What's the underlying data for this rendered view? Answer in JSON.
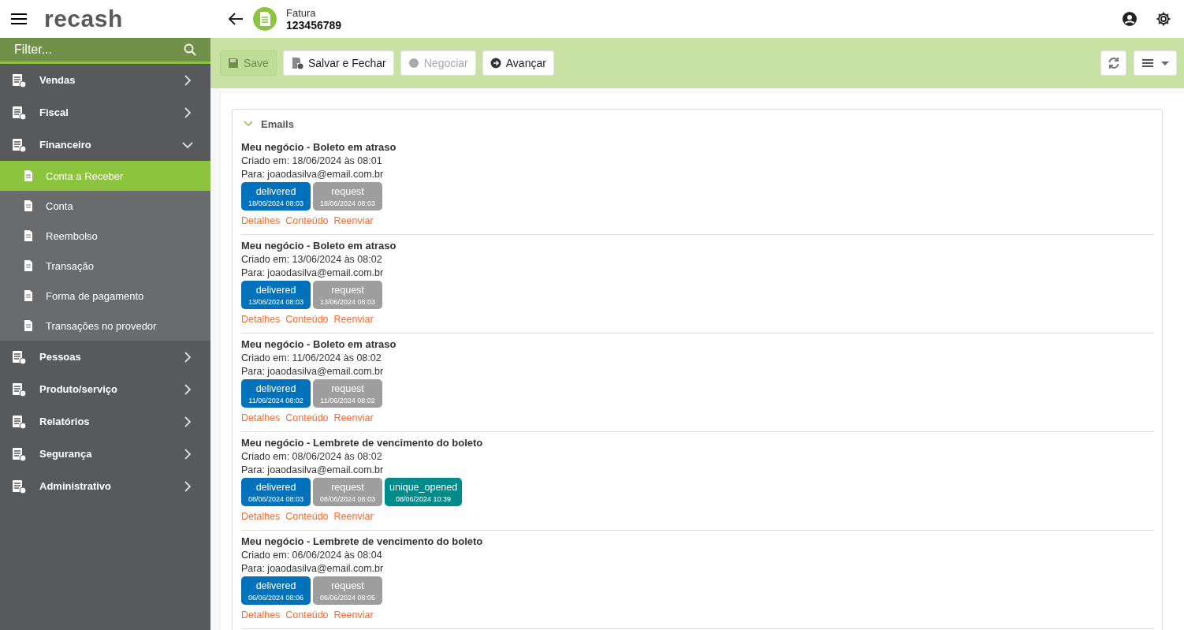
{
  "header": {
    "logo": "recash",
    "record_type": "Fatura",
    "record_number": "123456789"
  },
  "sidebar": {
    "filter_placeholder": "Filter...",
    "items": [
      {
        "label": "Vendas",
        "expanded": false
      },
      {
        "label": "Fiscal",
        "expanded": false
      },
      {
        "label": "Financeiro",
        "expanded": true,
        "children": [
          {
            "label": "Conta a Receber",
            "selected": true
          },
          {
            "label": "Conta",
            "selected": false
          },
          {
            "label": "Reembolso",
            "selected": false
          },
          {
            "label": "Transação",
            "selected": false
          },
          {
            "label": "Forma de pagamento",
            "selected": false
          },
          {
            "label": "Transações no provedor",
            "selected": false
          }
        ]
      },
      {
        "label": "Pessoas",
        "expanded": false
      },
      {
        "label": "Produto/serviço",
        "expanded": false
      },
      {
        "label": "Relatórios",
        "expanded": false
      },
      {
        "label": "Segurança",
        "expanded": false
      },
      {
        "label": "Administrativo",
        "expanded": false
      }
    ]
  },
  "toolbar": {
    "buttons": [
      {
        "label": "Save",
        "disabled": true
      },
      {
        "label": "Salvar e Fechar",
        "disabled": false
      },
      {
        "label": "Negociar",
        "disabled": true
      },
      {
        "label": "Avançar",
        "disabled": false
      }
    ]
  },
  "emails_panel": {
    "title": "Emails",
    "expanded": true,
    "emails": [
      {
        "subject": "Meu negócio - Boleto em atraso",
        "created": "Criado em: 18/06/2024 às 08:01",
        "to": "Para: joaodasilva@email.com.br",
        "events": [
          {
            "name": "delivered",
            "time": "18/06/2024 08:03",
            "color": "#0072bb"
          },
          {
            "name": "request",
            "time": "18/06/2024 08:03",
            "color": "#9e9e9e"
          }
        ],
        "links": [
          "Detalhes",
          "Conteúdo",
          "Reenviar"
        ]
      },
      {
        "subject": "Meu negócio - Boleto em atraso",
        "created": "Criado em: 13/06/2024 às 08:02",
        "to": "Para: joaodasilva@email.com.br",
        "events": [
          {
            "name": "delivered",
            "time": "13/06/2024 08:03",
            "color": "#0072bb"
          },
          {
            "name": "request",
            "time": "13/06/2024 08:03",
            "color": "#9e9e9e"
          }
        ],
        "links": [
          "Detalhes",
          "Conteúdo",
          "Reenviar"
        ]
      },
      {
        "subject": "Meu negócio - Boleto em atraso",
        "created": "Criado em: 11/06/2024 às 08:02",
        "to": "Para: joaodasilva@email.com.br",
        "events": [
          {
            "name": "delivered",
            "time": "11/06/2024 08:02",
            "color": "#0072bb"
          },
          {
            "name": "request",
            "time": "11/06/2024 08:02",
            "color": "#9e9e9e"
          }
        ],
        "links": [
          "Detalhes",
          "Conteúdo",
          "Reenviar"
        ]
      },
      {
        "subject": "Meu negócio - Lembrete de vencimento do boleto",
        "created": "Criado em: 08/06/2024 às 08:02",
        "to": "Para: joaodasilva@email.com.br",
        "events": [
          {
            "name": "delivered",
            "time": "08/06/2024 08:03",
            "color": "#0072bb"
          },
          {
            "name": "request",
            "time": "08/06/2024 08:03",
            "color": "#9e9e9e"
          },
          {
            "name": "unique_opened",
            "time": "08/06/2024 10:39",
            "color": "#008b8b"
          }
        ],
        "links": [
          "Detalhes",
          "Conteúdo",
          "Reenviar"
        ]
      },
      {
        "subject": "Meu negócio - Lembrete de vencimento do boleto",
        "created": "Criado em: 06/06/2024 às 08:04",
        "to": "Para: joaodasilva@email.com.br",
        "events": [
          {
            "name": "delivered",
            "time": "06/06/2024 08:06",
            "color": "#0072bb"
          },
          {
            "name": "request",
            "time": "06/06/2024 08:05",
            "color": "#9e9e9e"
          }
        ],
        "links": [
          "Detalhes",
          "Conteúdo",
          "Reenviar"
        ]
      }
    ]
  }
}
